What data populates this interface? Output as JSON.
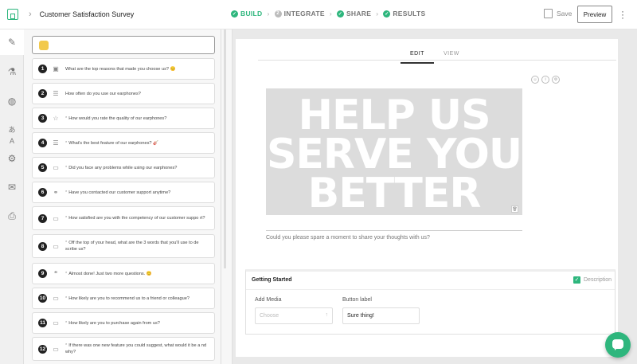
{
  "header": {
    "title": "Customer Satisfaction Survey",
    "steps": [
      {
        "label": "BUILD",
        "state": "active"
      },
      {
        "label": "INTEGRATE",
        "state": "todo"
      },
      {
        "label": "SHARE",
        "state": "done"
      },
      {
        "label": "RESULTS",
        "state": "done"
      }
    ],
    "save_label": "Save",
    "preview_label": "Preview"
  },
  "rail_icons": [
    "brush-icon",
    "paint-bucket-icon",
    "globe-icon",
    "translate-icon",
    "gear-icon",
    "mail-icon",
    "printer-icon"
  ],
  "questions": [
    {
      "num": "1",
      "icon": "image-icon",
      "required": false,
      "text": "What are the top reasons that made you choose us? 😊"
    },
    {
      "num": "2",
      "icon": "list-icon",
      "required": false,
      "text": "How often do you use our earphones?"
    },
    {
      "num": "3",
      "icon": "star-icon",
      "required": true,
      "text": "How would you rate the quality of our earphones?"
    },
    {
      "num": "4",
      "icon": "list-icon",
      "required": true,
      "text": "What's the best feature of our earphones? 🎸"
    },
    {
      "num": "5",
      "icon": "input-icon",
      "required": true,
      "text": "Did you face any problems while using our earphones?"
    },
    {
      "num": "6",
      "icon": "link-icon",
      "required": true,
      "text": "Have you contacted our customer support anytime?"
    },
    {
      "num": "7",
      "icon": "monitor-icon",
      "required": true,
      "text": "How satisfied are you with the competency of our customer suppo rt?"
    },
    {
      "num": "8",
      "icon": "input-icon",
      "required": true,
      "text": "Off the top of your head, what are the 3 words that you'll use to de scribe us?"
    },
    {
      "num": "9",
      "icon": "quote-icon",
      "required": true,
      "text": "Almost done! Just two more questions. 😊"
    },
    {
      "num": "10",
      "icon": "monitor-icon",
      "required": true,
      "text": "How likely are you to recommend us to a friend or colleague?"
    },
    {
      "num": "11",
      "icon": "monitor-icon",
      "required": true,
      "text": "How likely are you to purchase again from us?"
    },
    {
      "num": "12",
      "icon": "input-icon",
      "required": true,
      "text": "If there was one new feature you could suggest, what would it be a nd why?"
    }
  ],
  "editor": {
    "tabs": [
      "EDIT",
      "VIEW"
    ],
    "hero_lines": [
      "HELP US",
      "SERVE YOU",
      "BETTER"
    ],
    "description": "Could you please spare a moment to share your thoughts with us?"
  },
  "settings": {
    "title": "Getting Started",
    "description_label": "Description",
    "add_media_label": "Add Media",
    "add_media_placeholder": "Choose",
    "button_label_label": "Button label",
    "button_label_value": "Sure thing!"
  },
  "colors": {
    "accent": "#2eb67d"
  }
}
